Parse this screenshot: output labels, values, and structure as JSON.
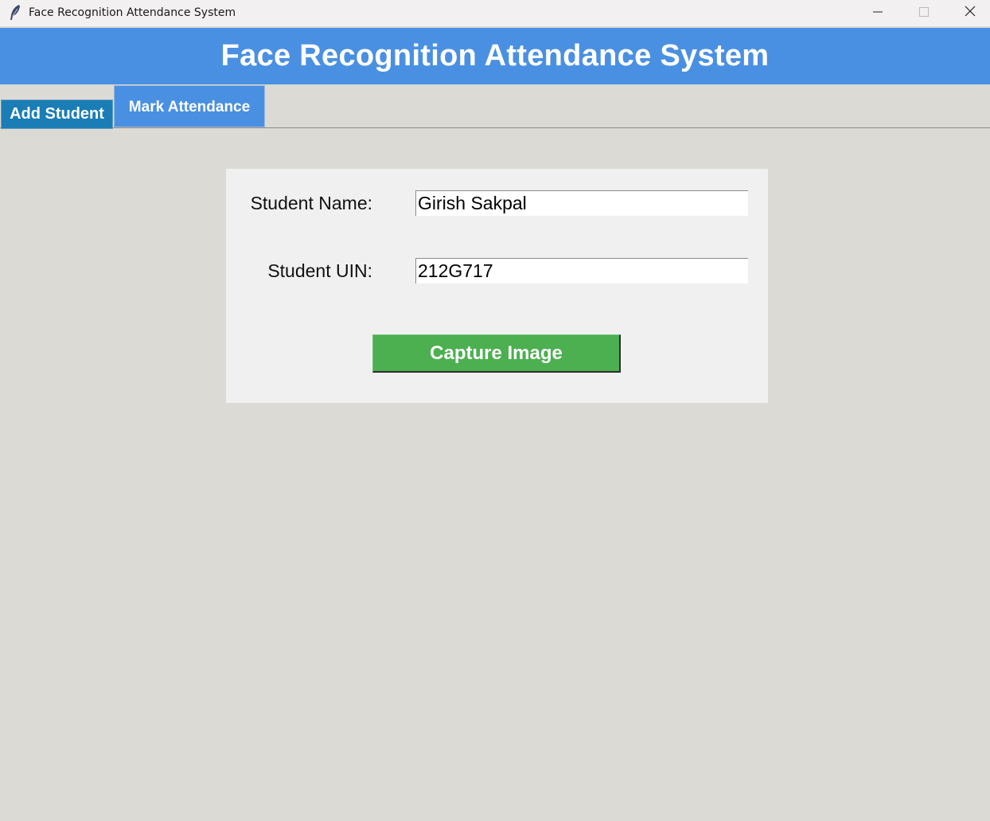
{
  "window": {
    "title": "Face Recognition Attendance System",
    "icon": "feather-icon"
  },
  "header": {
    "title": "Face Recognition Attendance System",
    "background": "#4a90e2"
  },
  "tabs": [
    {
      "label": "Add Student",
      "selected": true,
      "color": "#1a7db6"
    },
    {
      "label": "Mark Attendance",
      "selected": false,
      "color": "#4a90e2"
    }
  ],
  "form": {
    "name_label": "Student Name:",
    "name_value": "Girish Sakpal",
    "uin_label": "Student UIN:",
    "uin_value": "212G717",
    "capture_label": "Capture Image",
    "capture_color": "#4caf50"
  },
  "window_controls": [
    "minimize-icon",
    "maximize-icon",
    "close-icon"
  ]
}
